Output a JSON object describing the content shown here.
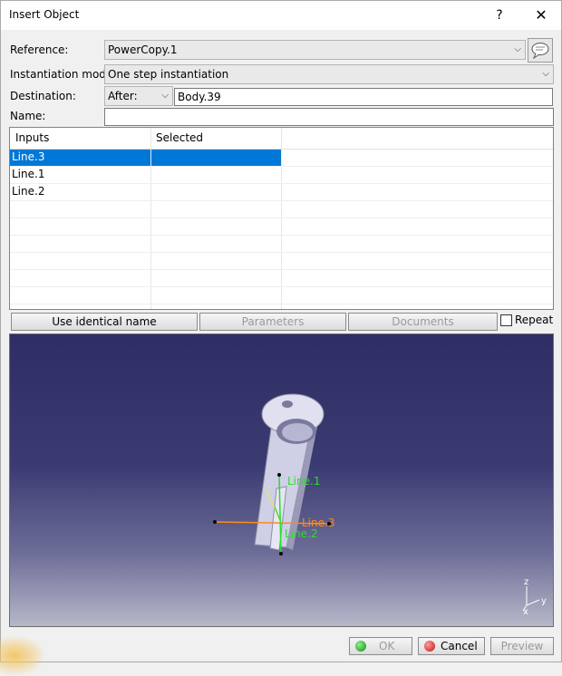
{
  "window": {
    "title": "Insert Object",
    "help": "?",
    "close": "✕"
  },
  "reference": {
    "label": "Reference:",
    "value": "PowerCopy.1"
  },
  "instantiation": {
    "label": "Instantiation mode:",
    "value": "One step instantiation"
  },
  "destination": {
    "label": "Destination:",
    "position": "After:",
    "target": "Body.39"
  },
  "name": {
    "label": "Name:",
    "value": ""
  },
  "table": {
    "headers": [
      "Inputs",
      "Selected"
    ],
    "rows": [
      {
        "input": "Line.3",
        "selected": ""
      },
      {
        "input": "Line.1",
        "selected": ""
      },
      {
        "input": "Line.2",
        "selected": ""
      }
    ]
  },
  "actions": {
    "use_identical_name": "Use identical name",
    "parameters": "Parameters",
    "documents": "Documents",
    "repeat": "Repeat"
  },
  "viewer": {
    "labels": {
      "line1": "Line.1",
      "line2": "Line.2",
      "line3": "Line.3"
    },
    "axes": {
      "z": "z",
      "y": "y",
      "x": "x"
    }
  },
  "footer": {
    "ok": "OK",
    "cancel": "Cancel",
    "preview": "Preview"
  },
  "colors": {
    "selection": "#0078d7",
    "line_green": "#28e028",
    "line_orange": "#ff8a1c"
  }
}
